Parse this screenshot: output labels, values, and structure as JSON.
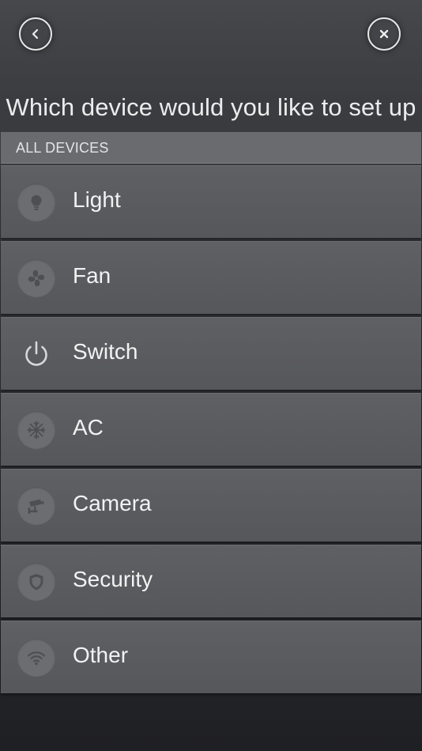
{
  "nav": {
    "back_icon": "chevron-left-icon",
    "close_icon": "close-icon"
  },
  "title": "Which device would you like to set up",
  "section_header": "ALL DEVICES",
  "devices": [
    {
      "label": "Light",
      "icon": "lightbulb-icon"
    },
    {
      "label": "Fan",
      "icon": "fan-icon"
    },
    {
      "label": "Switch",
      "icon": "power-icon"
    },
    {
      "label": "AC",
      "icon": "snowflake-icon"
    },
    {
      "label": "Camera",
      "icon": "security-camera-icon"
    },
    {
      "label": "Security",
      "icon": "shield-icon"
    },
    {
      "label": "Other",
      "icon": "wifi-icon"
    }
  ],
  "colors": {
    "background_top": "#47484c",
    "background_bottom": "#1f2024",
    "row": "#5a5b5f",
    "header": "#6a6b6f",
    "icon_circle": "#6c6d71",
    "icon_glyph": "#4e4f53",
    "text": "#f2f2f2"
  }
}
